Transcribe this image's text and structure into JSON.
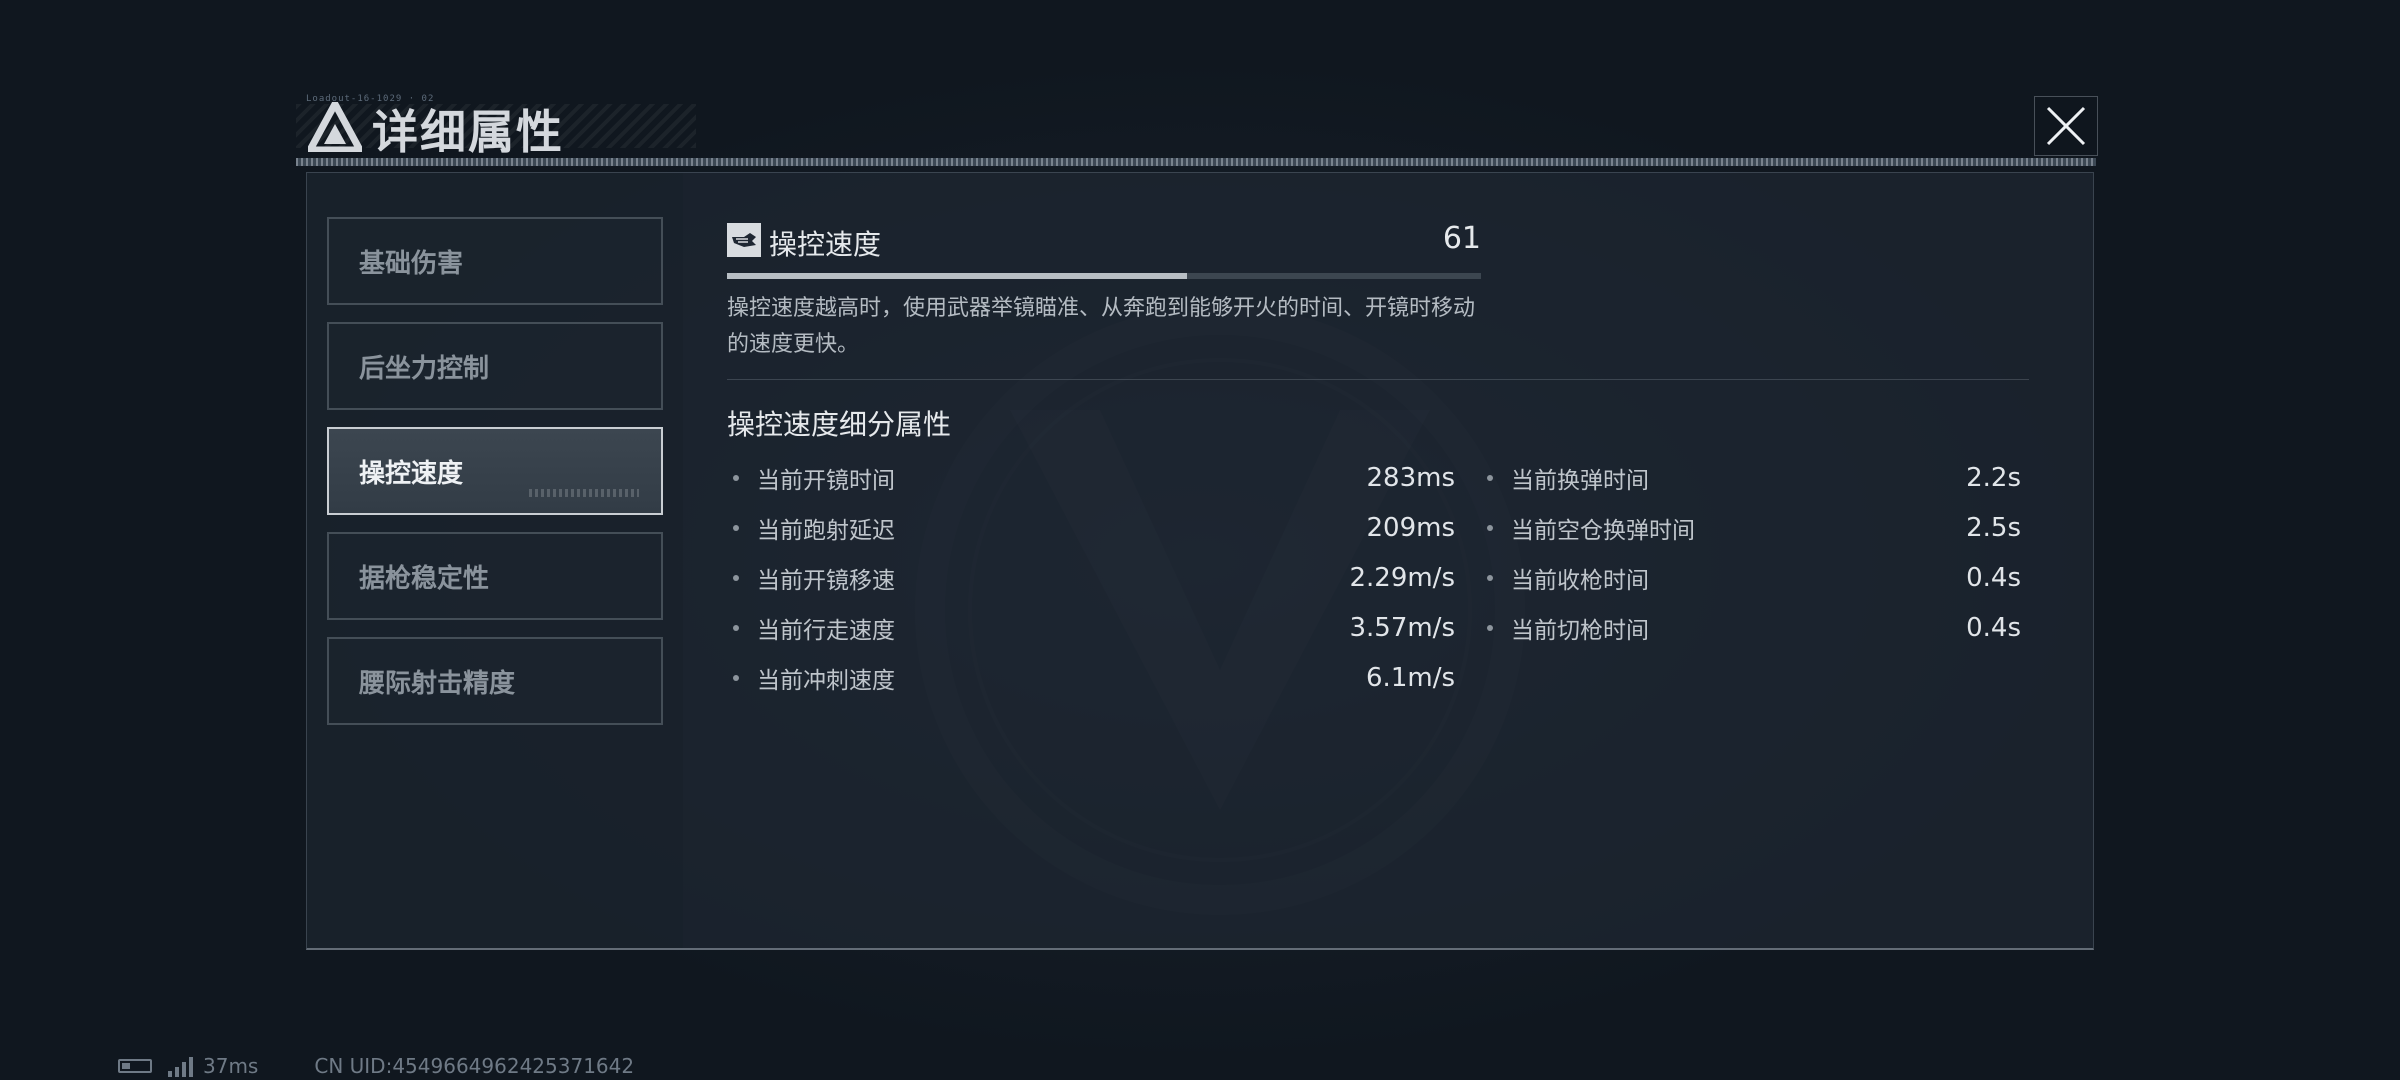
{
  "window": {
    "title": "详细属性",
    "close_icon": "close-x-icon",
    "code_text": "Loadout-16-1029 · 02"
  },
  "tabs": [
    {
      "label": "基础伤害",
      "active": false
    },
    {
      "label": "后坐力控制",
      "active": false
    },
    {
      "label": "操控速度",
      "active": true
    },
    {
      "label": "据枪稳定性",
      "active": false
    },
    {
      "label": "腰际射击精度",
      "active": false
    }
  ],
  "stat": {
    "icon": "hand-icon",
    "name": "操控速度",
    "value": "61",
    "bar_fraction": 0.61,
    "description": "操控速度越高时，使用武器举镜瞄准、从奔跑到能够开火的时间、开镜时移动的速度更快。"
  },
  "breakdown": {
    "title": "操控速度细分属性",
    "left": [
      {
        "label": "当前开镜时间",
        "value": "283ms"
      },
      {
        "label": "当前跑射延迟",
        "value": "209ms"
      },
      {
        "label": "当前开镜移速",
        "value": "2.29m/s"
      },
      {
        "label": "当前行走速度",
        "value": "3.57m/s"
      },
      {
        "label": "当前冲刺速度",
        "value": "6.1m/s"
      }
    ],
    "right": [
      {
        "label": "当前换弹时间",
        "value": "2.2s"
      },
      {
        "label": "当前空仓换弹时间",
        "value": "2.5s"
      },
      {
        "label": "当前收枪时间",
        "value": "0.4s"
      },
      {
        "label": "当前切枪时间",
        "value": "0.4s"
      }
    ]
  },
  "status_bar": {
    "ping": "37ms",
    "uid": "CN UID:4549664962425371642"
  },
  "colors": {
    "background": "#131b25",
    "panel": "#1e2732",
    "accent": "#c9ced3",
    "text": "#e6e9ec"
  }
}
